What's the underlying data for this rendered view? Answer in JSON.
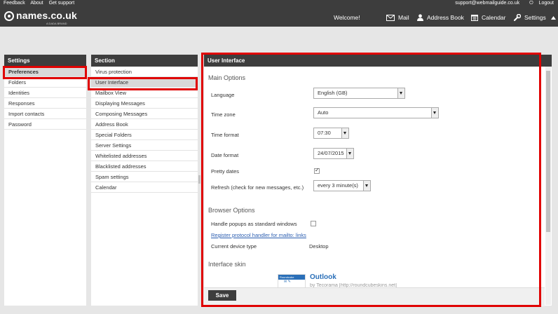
{
  "top": {
    "links_left": [
      "Feedback",
      "About",
      "Get support"
    ],
    "email": "support@webmailguide.co.uk",
    "logout": "Logout",
    "logo_text": "names.co.uk",
    "logo_tagline": "A DADA BRAND",
    "welcome": "Welcome!",
    "nav": {
      "mail": "Mail",
      "address_book": "Address Book",
      "calendar": "Calendar",
      "settings": "Settings"
    }
  },
  "settings_panel": {
    "title": "Settings",
    "items": [
      "Preferences",
      "Folders",
      "Identities",
      "Responses",
      "Import contacts",
      "Password"
    ],
    "selected": "Preferences"
  },
  "section_panel": {
    "title": "Section",
    "items": [
      "Virus protection",
      "User Interface",
      "Mailbox View",
      "Displaying Messages",
      "Composing Messages",
      "Address Book",
      "Special Folders",
      "Server Settings",
      "Whitelisted addresses",
      "Blacklisted addresses",
      "Spam settings",
      "Calendar"
    ],
    "selected": "User Interface"
  },
  "main": {
    "title": "User Interface",
    "main_options": {
      "heading": "Main Options",
      "language_label": "Language",
      "language_value": "English (GB)",
      "timezone_label": "Time zone",
      "timezone_value": "Auto",
      "timeformat_label": "Time format",
      "timeformat_value": "07:30",
      "dateformat_label": "Date format",
      "dateformat_value": "24/07/2015",
      "prettydates_label": "Pretty dates",
      "prettydates_checked": true,
      "refresh_label": "Refresh (check for new messages, etc.)",
      "refresh_value": "every 3 minute(s)"
    },
    "browser_options": {
      "heading": "Browser Options",
      "popups_label": "Handle popups as standard windows",
      "popups_checked": false,
      "protocol_link": "Register protocol handler for mailto: links",
      "device_label": "Current device type",
      "device_value": "Desktop"
    },
    "skin": {
      "heading": "Interface skin",
      "thumb_label": "Roundcube",
      "name": "Outlook",
      "by": "by Tecorama [http://roundcubeskins.net]"
    },
    "save": "Save"
  },
  "colors": {
    "header_bg": "#3d3d3d",
    "highlight": "#e00000",
    "link": "#2a5db0"
  }
}
